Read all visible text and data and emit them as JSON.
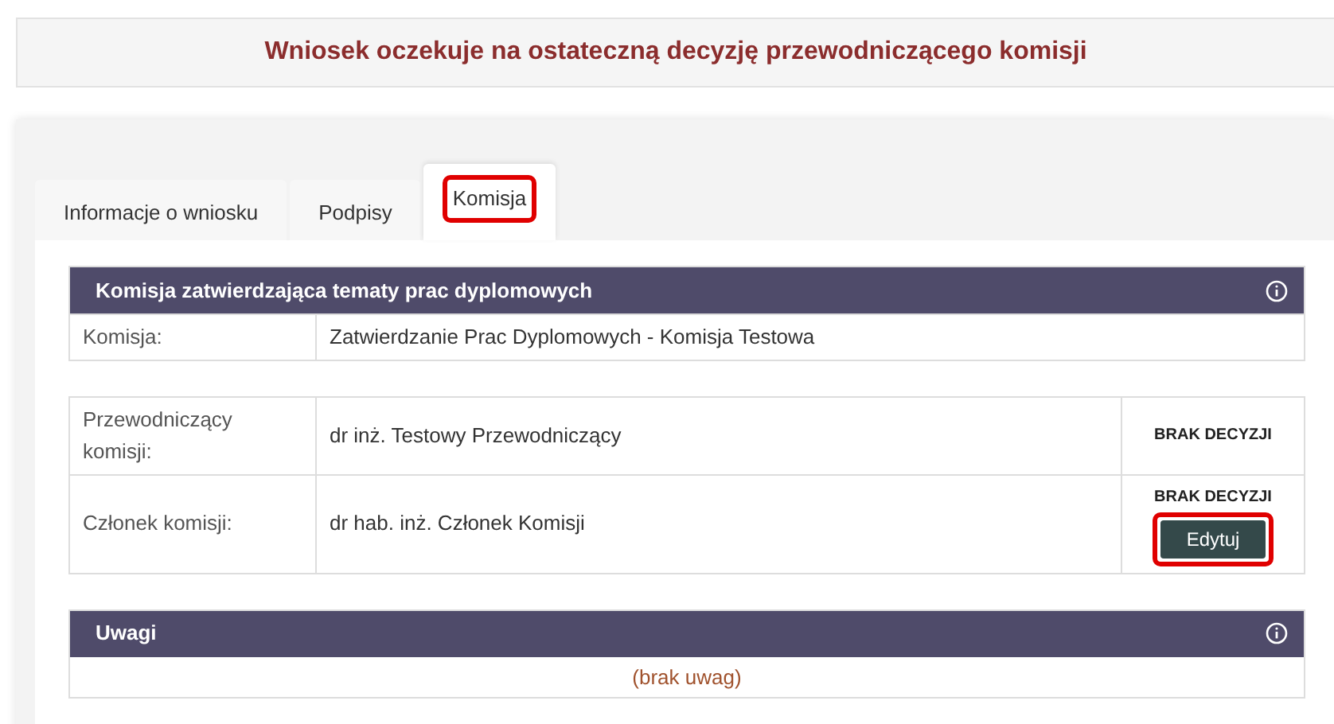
{
  "banner": {
    "text": "Wniosek oczekuje na ostateczną decyzję przewodniczącego komisji"
  },
  "tabs": [
    {
      "label": "Informacje o wniosku",
      "selected": false,
      "highlighted": false
    },
    {
      "label": "Podpisy",
      "selected": false,
      "highlighted": false
    },
    {
      "label": "Komisja",
      "selected": true,
      "highlighted": true
    }
  ],
  "committee_section": {
    "title": "Komisja zatwierdzająca tematy prac dyplomowych",
    "rows": [
      {
        "label": "Komisja:",
        "value": "Zatwierdzanie Prac Dyplomowych - Komisja Testowa"
      }
    ]
  },
  "members": [
    {
      "role": "Przewodniczący komisji:",
      "name": "dr inż. Testowy Przewodniczący",
      "decision": "BRAK DECYZJI"
    },
    {
      "role": "Członek komisji:",
      "name": "dr hab. inż. Członek Komisji",
      "decision": "BRAK DECYZJI",
      "button": {
        "label": "Edytuj",
        "highlighted": true
      }
    }
  ],
  "notes_section": {
    "title": "Uwagi",
    "empty_text": "(brak uwag)"
  }
}
